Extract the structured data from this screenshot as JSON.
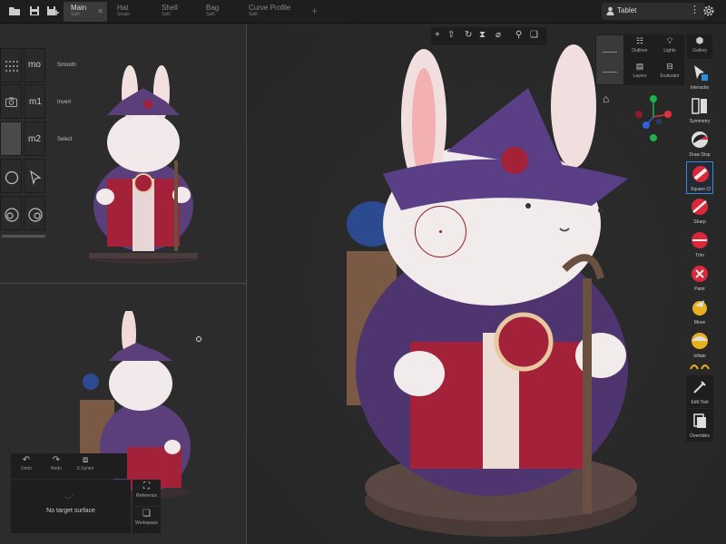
{
  "tabs": [
    {
      "title": "Main",
      "sub": "Split"
    },
    {
      "title": "Hat",
      "sub": "Single"
    },
    {
      "title": "Shell",
      "sub": "Split"
    },
    {
      "title": "Bag",
      "sub": "Split"
    },
    {
      "title": "Curve Profile",
      "sub": "Split"
    }
  ],
  "tablet_label": "Tablet",
  "left_tools": {
    "smooth": {
      "key": "mo",
      "label": "Smooth"
    },
    "invert": {
      "key": "m1",
      "label": "Invert"
    },
    "select": {
      "key": "m2",
      "label": "Select"
    }
  },
  "undo_bar": {
    "undo": "Undo",
    "redo": "Redo",
    "symm": "S.Symm"
  },
  "target": {
    "dots": "-.-'",
    "message": "No target surface"
  },
  "side_buttons": {
    "reference": "Reference",
    "workspace": "Workspace"
  },
  "panel_grid": {
    "outliner": "Outliner",
    "lights": "Lights",
    "layers": "Layers",
    "evaluator": "Evaluator",
    "gallery": "Gallery"
  },
  "tools": [
    {
      "label": "Interactio",
      "icon": "cursor-icon"
    },
    {
      "label": "Symmetry",
      "icon": "symmetry-icon"
    },
    {
      "label": "Draw Disp",
      "icon": "draw-disp-icon"
    },
    {
      "label": "Square Cl",
      "icon": "square-clay-icon"
    },
    {
      "label": "Sharp",
      "icon": "sharp-icon"
    },
    {
      "label": "Trim",
      "icon": "trim-icon"
    },
    {
      "label": "Paint",
      "icon": "paint-icon"
    },
    {
      "label": "Move",
      "icon": "move-icon"
    },
    {
      "label": "Inflate",
      "icon": "inflate-icon"
    },
    {
      "label": "Edit Tool",
      "icon": "edit-tool-icon"
    },
    {
      "label": "Overrides",
      "icon": "overrides-icon"
    }
  ],
  "colors": {
    "accent": "#3a86d8",
    "tool_red": "#d8283c",
    "tool_yellow": "#e8b020",
    "gizmo_red": "#e0303c",
    "gizmo_green": "#1fb04a",
    "gizmo_blue": "#3060d8"
  }
}
